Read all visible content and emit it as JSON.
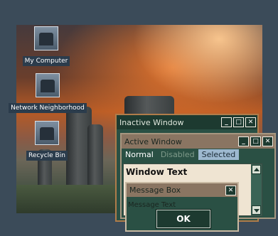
{
  "desktop": {
    "icons": [
      {
        "label": "My Computer",
        "icon": "computer-icon"
      },
      {
        "label": "Network Neighborhood",
        "icon": "network-icon"
      },
      {
        "label": "Recycle Bin",
        "icon": "recycle-bin-icon"
      }
    ]
  },
  "inactive_window": {
    "title": "Inactive Window",
    "controls": {
      "minimize": "_",
      "maximize": "□",
      "close": "✕"
    }
  },
  "active_window": {
    "title": "Active Window",
    "controls": {
      "minimize": "_",
      "maximize": "□",
      "close": "✕"
    },
    "menu": {
      "normal": "Normal",
      "disabled": "Disabled",
      "selected": "Selected"
    },
    "window_text": "Window Text"
  },
  "message_box": {
    "title": "Message Box",
    "close": "✕",
    "text": "Message Text",
    "ok": "OK"
  },
  "colors": {
    "desktop_frame": "#3b4b59",
    "window_bg": "#2a5044",
    "active_title": "#8a7562",
    "inactive_title": "#1d3a30",
    "selected_menu": "#9db8cf",
    "client_bg": "#efe4d2"
  }
}
